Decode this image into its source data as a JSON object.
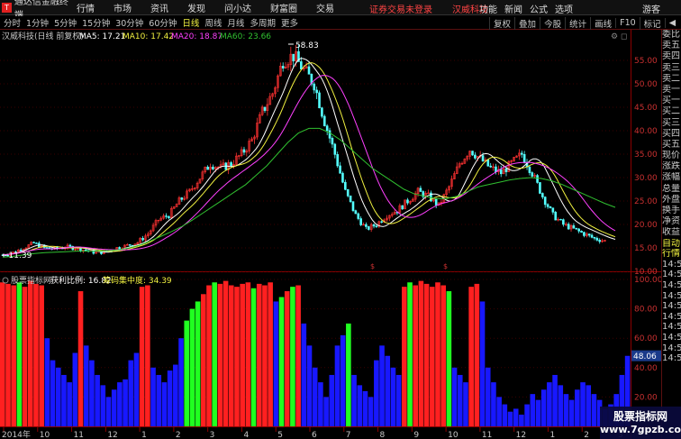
{
  "titlebar": {
    "app_name": "通达信金融终端",
    "menus": [
      "行情",
      "市场",
      "资讯",
      "发现",
      "问小达",
      "财富圈",
      "交易"
    ],
    "warning": "证券交易未登录",
    "stock": "汉威科技",
    "right_menus": [
      "功能",
      "新闻",
      "公式",
      "选项"
    ],
    "user": "游客"
  },
  "toolbar": {
    "periods": [
      "分时",
      "1分钟",
      "5分钟",
      "15分钟",
      "30分钟",
      "60分钟",
      "日线",
      "周线",
      "月线",
      "多周期",
      "更多"
    ],
    "active_period": "日线",
    "tools": [
      "复权",
      "叠加",
      "今股",
      "统计",
      "画线",
      "F10",
      "标记",
      "◀"
    ]
  },
  "main_chart": {
    "stock_label": "汉威科技(日线 前复权)",
    "ma5_label": "MA5: 17.21",
    "ma10_label": "MA10: 17.42",
    "ma20_label": "MA20: 18.87",
    "ma60_label": "MA60: 23.66",
    "peak_label": "58.83",
    "low_label": "11.39",
    "y_ticks": [
      "55.00",
      "50.00",
      "45.00",
      "40.00",
      "35.00",
      "30.00",
      "25.00",
      "20.00",
      "15.00",
      "10.00"
    ]
  },
  "indicator": {
    "name_label": "股票指标网",
    "profit_label": "获利比例: 16.82",
    "chip_label": "筹码集中度: 34.39",
    "y_ticks": [
      "100.00",
      "80.00",
      "60.00",
      "40.00",
      "20.00"
    ],
    "current_value": "48.06"
  },
  "x_axis": {
    "labels": [
      "2014年",
      "10",
      "11",
      "12",
      "1",
      "2",
      "3",
      "4",
      "5",
      "6",
      "7",
      "8",
      "9",
      "10",
      "11",
      "12",
      "1",
      "2",
      "3"
    ]
  },
  "sidebar": {
    "items": [
      "委比",
      "卖五",
      "卖四",
      "卖三",
      "卖二",
      "卖一",
      "买一",
      "买二",
      "买三",
      "买四",
      "买五",
      "现价",
      "涨跌",
      "涨幅",
      "总量",
      "外盘",
      "换手",
      "净资",
      "收益"
    ],
    "subitems": [
      "自动",
      "行情",
      "14:50",
      "14:50",
      "14:50",
      "14:50",
      "14:50",
      "14:50",
      "14:50",
      "14:50",
      "14:50",
      "14:50"
    ]
  },
  "watermark": {
    "line1": "股票指标网",
    "line2": "www.7gpzb.com"
  },
  "chart_data": {
    "type": "candlestick_with_bar_indicator",
    "price_series": {
      "ylim": [
        10,
        60
      ],
      "close": [
        13.5,
        14.0,
        15.0,
        16.0,
        15.0,
        14.8,
        15.2,
        15.0,
        14.5,
        14.0,
        14.2,
        15.0,
        15.5,
        16.2,
        18,
        21,
        22,
        25,
        27,
        30,
        33,
        32,
        33,
        35,
        38,
        44,
        48,
        55,
        56,
        53,
        50,
        42,
        35,
        27,
        22,
        19,
        20,
        22,
        23,
        25,
        27,
        26,
        24,
        28,
        33,
        36,
        34,
        32,
        31,
        33,
        35,
        31,
        26,
        22,
        20,
        19,
        18,
        17,
        16.5
      ],
      "ma60": [
        13,
        13.2,
        13.5,
        13.8,
        14,
        14.1,
        14.2,
        14.3,
        14.3,
        14.3,
        14.4,
        14.6,
        15,
        15.6,
        16.5,
        17.5,
        18.5,
        19.6,
        21,
        22.5,
        24,
        25.5,
        27,
        28.5,
        30.5,
        32.5,
        35,
        37.5,
        39.5,
        40.5,
        40.5,
        39.5,
        38,
        36,
        34,
        32,
        30.5,
        29,
        27.5,
        26.5,
        26,
        25.5,
        25.5,
        26,
        27,
        28,
        28.5,
        29,
        29.5,
        29.8,
        30,
        29.8,
        29.3,
        28.5,
        27.5,
        26.5,
        25.5,
        24.5,
        23.66
      ]
    },
    "indicator_series": {
      "ylim": [
        0,
        100
      ],
      "values": [
        98,
        97,
        96,
        98,
        95,
        99,
        97,
        96,
        60,
        45,
        40,
        35,
        30,
        50,
        92,
        55,
        45,
        35,
        28,
        20,
        25,
        30,
        32,
        45,
        50,
        95,
        96,
        40,
        35,
        30,
        38,
        42,
        60,
        72,
        80,
        85,
        90,
        96,
        98,
        97,
        99,
        96,
        95,
        97,
        98,
        94,
        97,
        96,
        98,
        85,
        88,
        92,
        95,
        96,
        70,
        55,
        40,
        30,
        20,
        35,
        55,
        62,
        70,
        35,
        28,
        24,
        20,
        45,
        55,
        48,
        40,
        35,
        95,
        98,
        96,
        99,
        97,
        95,
        98,
        96,
        92,
        40,
        35,
        30,
        95,
        97,
        85,
        40,
        30,
        20,
        15,
        10,
        12,
        8,
        15,
        22,
        18,
        25,
        30,
        35,
        28,
        22,
        18,
        25,
        30,
        28,
        22,
        18,
        12,
        15,
        22,
        35,
        48
      ]
    }
  }
}
